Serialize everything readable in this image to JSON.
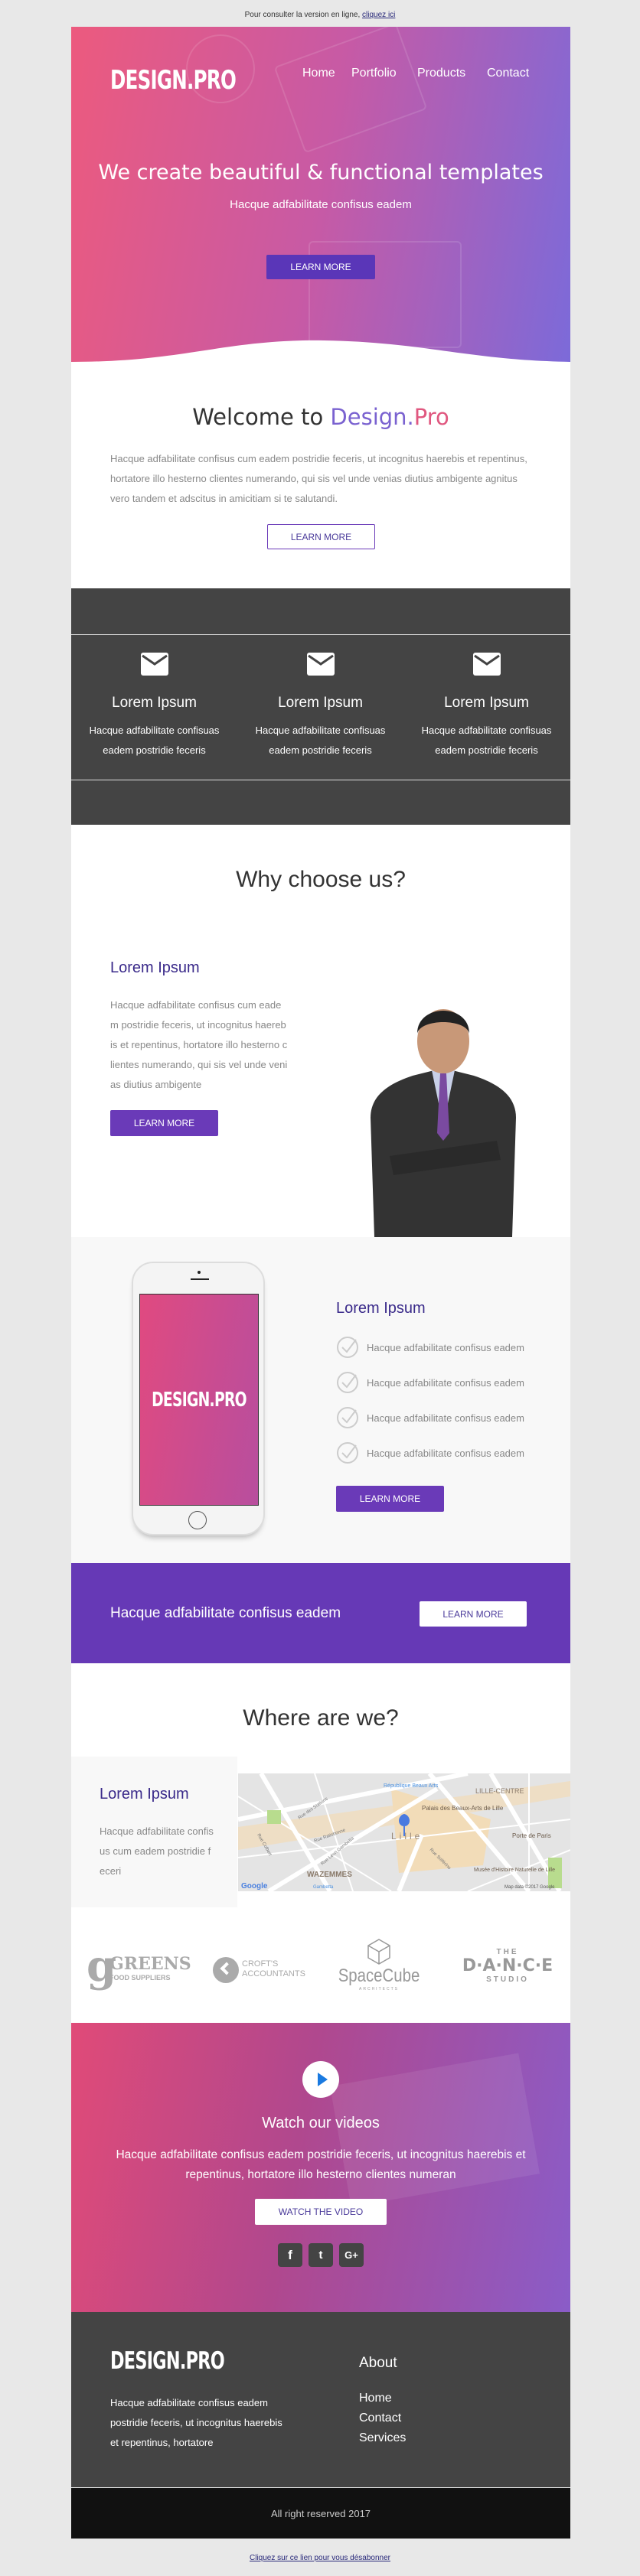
{
  "topbar": {
    "text": "Pour consulter la version en ligne,",
    "link": "cliquez ici"
  },
  "brand": "DESIGN.PRO",
  "nav": [
    "Home",
    "Portfolio",
    "Products",
    "Contact"
  ],
  "hero": {
    "title": "We create beautiful & functional templates",
    "subtitle": "Hacque adfabilitate confisus eadem",
    "button": "LEARN MORE"
  },
  "welcome": {
    "title_prefix": "Welcome to ",
    "title_brand1": "Design.",
    "title_brand2": "Pro",
    "text": "Hacque adfabilitate confisus cum eadem postridie feceris, ut incognitus haerebis et repentinus, hortatore illo hesterno clientes numerando, qui sis vel unde venias diutius ambigente agnitus vero tandem et adscitus in amicitiam si te salutandi.",
    "button": "LEARN MORE"
  },
  "features": [
    {
      "icon": "envelope-icon",
      "title": "Lorem Ipsum",
      "text": "Hacque adfabilitate confisuas eadem postridie feceris"
    },
    {
      "icon": "envelope-icon",
      "title": "Lorem Ipsum",
      "text": "Hacque adfabilitate confisuas eadem postridie feceris"
    },
    {
      "icon": "envelope-icon",
      "title": "Lorem Ipsum",
      "text": "Hacque adfabilitate confisuas eadem postridie feceris"
    }
  ],
  "why": {
    "title": "Why choose us?",
    "heading": "Lorem Ipsum",
    "text": "Hacque adfabilitate confisus cum eadem postridie feceris, ut incognitus haerebis et repentinus, hortatore illo hesterno clientes numerando, qui sis vel unde venias diutius ambigente",
    "button": "LEARN MORE"
  },
  "app": {
    "phone_brand": "DESIGN.PRO",
    "heading": "Lorem Ipsum",
    "items": [
      "Hacque adfabilitate confisus eadem",
      "Hacque adfabilitate confisus eadem",
      "Hacque adfabilitate confisus eadem",
      "Hacque adfabilitate confisus eadem"
    ],
    "button": "LEARN MORE"
  },
  "cta": {
    "text": "Hacque adfabilitate confisus eadem",
    "button": "LEARN MORE"
  },
  "location": {
    "title": "Where are we?",
    "heading": "Lorem Ipsum",
    "text": "Hacque adfabilitate confisus cum eadem postridie feceri",
    "map_labels": [
      "République Beaux Arts",
      "LILLE-CENTRE",
      "Palais des Beaux-Arts de Lille",
      "Lille",
      "Porte de Paris",
      "WAZEMMES",
      "Musée d'Histoire Naturelle de Lille",
      "Rue des Stations",
      "Rue Ratisbonne",
      "Rue Léon Gambetta",
      "Rue Solférino",
      "Rue Colbert",
      "Gambetta",
      "Google",
      "Map data ©2017 Google"
    ]
  },
  "partners": [
    {
      "name": "GREENS",
      "sub": "FOOD SUPPLIERS"
    },
    {
      "name": "CROFT'S",
      "sub": "ACCOUNTANTS"
    },
    {
      "name": "SpaceCube",
      "sub": "ARCHITECTS"
    },
    {
      "name": "D·A·N·C·E",
      "top": "THE",
      "sub": "STUDIO"
    }
  ],
  "video": {
    "title": "Watch our videos",
    "text": "Hacque adfabilitate confisus eadem postridie feceris, ut incognitus haerebis et repentinus, hortatore illo hesterno clientes numeran",
    "button": "WATCH THE VIDEO",
    "social": [
      "f",
      "t",
      "G+"
    ]
  },
  "footer": {
    "text": "Hacque adfabilitate confisus eadem postridie feceris, ut incognitus haerebis et repentinus, hortatore",
    "links_title": "About",
    "links": [
      "Home",
      "Contact",
      "Services"
    ],
    "copyright": "All right reserved 2017"
  },
  "unsubscribe": "Cliquez sur ce lien pour vous désabonner",
  "colors": {
    "accent": "#6a3ab8",
    "dark": "#444444",
    "black": "#111111",
    "hero_start": "#ec5a7e",
    "hero_end": "#7c6ad9"
  }
}
